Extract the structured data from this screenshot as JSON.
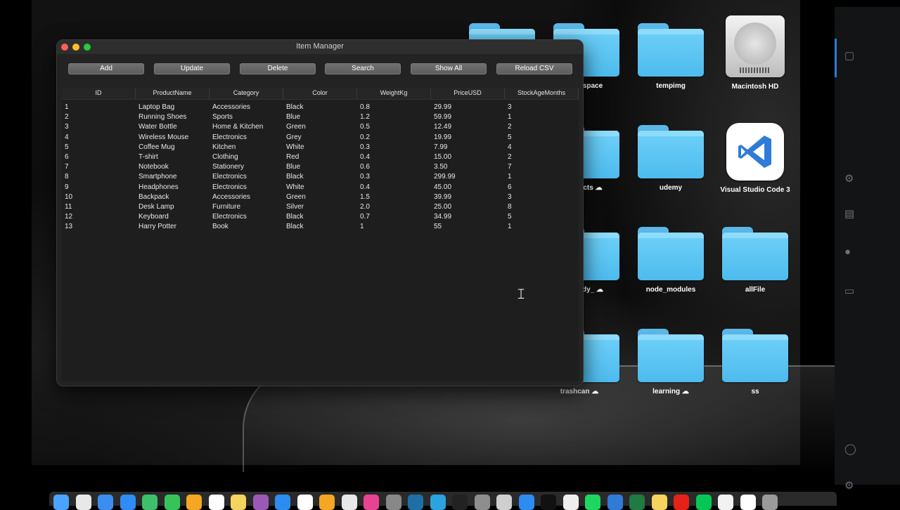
{
  "window": {
    "title": "Item Manager"
  },
  "toolbar": {
    "buttons": [
      "Add",
      "Update",
      "Delete",
      "Search",
      "Show All",
      "Reload CSV"
    ]
  },
  "table": {
    "columns": [
      "ID",
      "ProductName",
      "Category",
      "Color",
      "WeightKg",
      "PriceUSD",
      "StockAgeMonths"
    ],
    "rows": [
      [
        "1",
        "Laptop Bag",
        "Accessories",
        "Black",
        "0.8",
        "29.99",
        "3"
      ],
      [
        "2",
        "Running Shoes",
        "Sports",
        "Blue",
        "1.2",
        "59.99",
        "1"
      ],
      [
        "3",
        "Water Bottle",
        "Home & Kitchen",
        "Green",
        "0.5",
        "12.49",
        "2"
      ],
      [
        "4",
        "Wireless Mouse",
        "Electronics",
        "Grey",
        "0.2",
        "19.99",
        "5"
      ],
      [
        "5",
        "Coffee Mug",
        "Kitchen",
        "White",
        "0.3",
        "7.99",
        "4"
      ],
      [
        "6",
        "T-shirt",
        "Clothing",
        "Red",
        "0.4",
        "15.00",
        "2"
      ],
      [
        "7",
        "Notebook",
        "Stationery",
        "Blue",
        "0.6",
        "3.50",
        "7"
      ],
      [
        "8",
        "Smartphone",
        "Electronics",
        "Black",
        "0.3",
        "299.99",
        "1"
      ],
      [
        "9",
        "Headphones",
        "Electronics",
        "White",
        "0.4",
        "45.00",
        "6"
      ],
      [
        "10",
        "Backpack",
        "Accessories",
        "Green",
        "1.5",
        "39.99",
        "3"
      ],
      [
        "11",
        "Desk Lamp",
        "Furniture",
        "Silver",
        "2.0",
        "25.00",
        "8"
      ],
      [
        "12",
        "Keyboard",
        "Electronics",
        "Black",
        "0.7",
        "34.99",
        "5"
      ],
      [
        "13",
        "Harry Potter",
        "Book",
        "Black",
        "1",
        "55",
        "1"
      ]
    ]
  },
  "desktop": {
    "icons": [
      {
        "label": "space",
        "kind": "folder"
      },
      {
        "label": "tempimg",
        "kind": "folder"
      },
      {
        "label": "Macintosh HD",
        "kind": "hard-drive"
      },
      {
        "label": "cts",
        "kind": "folder"
      },
      {
        "label": "udemy",
        "kind": "folder"
      },
      {
        "label": "Visual Studio Code 3",
        "kind": "app"
      },
      {
        "label": "dy_",
        "kind": "folder"
      },
      {
        "label": "node_modules",
        "kind": "folder"
      },
      {
        "label": "allFile",
        "kind": "folder"
      },
      {
        "label": "trashcan",
        "kind": "folder"
      },
      {
        "label": "learning",
        "kind": "folder"
      },
      {
        "label": "ss",
        "kind": "folder"
      }
    ]
  },
  "colors": {
    "folder": "#5ab8e8",
    "window_bg": "#232323",
    "button_bg": "#666666",
    "close": "#fe5f57",
    "minimize": "#febc2e",
    "maximize": "#28c840",
    "vscode_blue": "#2f7bd8"
  },
  "dock": {
    "icons": [
      "finder-icon",
      "launchpad-icon",
      "mail-icon",
      "safari-icon",
      "maps-icon",
      "facetime-icon",
      "photos-icon",
      "calendar-icon",
      "notes-icon",
      "podcasts-icon",
      "appstore-icon",
      "reminders-icon",
      "pages-icon",
      "chrome-icon",
      "app-icon",
      "help-icon",
      "mysql-icon",
      "telegram-icon",
      "tv-icon",
      "settings-icon",
      "roblox-icon",
      "appstore2-icon",
      "seven-icon",
      "notion-icon",
      "spotify-icon",
      "vscode-icon",
      "excel-icon",
      "notes2-icon",
      "youtube-icon",
      "line-icon",
      "onlineapp-icon",
      "file-icon",
      "trash-icon"
    ]
  }
}
